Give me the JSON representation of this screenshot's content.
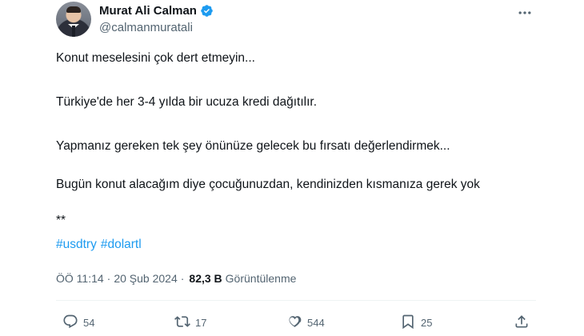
{
  "author": {
    "name": "Murat Ali Calman",
    "handle": "@calmanmuratali",
    "verified_icon": "verified-badge-icon",
    "badge_color": "#1d9bf0"
  },
  "tweet": {
    "lines": [
      "Konut meselesini çok dert etmeyin...",
      "Türkiye'de her 3-4 yılda bir ucuza kredi dağıtılır.",
      "Yapmanız gereken tek şey önünüze gelecek bu fırsatı değerlendirmek...",
      "Bugün konut alacağım diye çocuğunuzdan, kendinizden kısmanıza gerek yok",
      "**"
    ],
    "hashtags": [
      "#usdtry",
      "#dolartl"
    ]
  },
  "meta": {
    "time": "ÖÖ 11:14",
    "separator": "·",
    "date": "20 Şub 2024",
    "views_count": "82,3 B",
    "views_label": "Görüntülenme"
  },
  "actions": {
    "reply_count": "54",
    "retweet_count": "17",
    "like_count": "544",
    "bookmark_count": "25"
  },
  "colors": {
    "link": "#1d9bf0",
    "secondary_text": "#536471",
    "primary_text": "#0f1419"
  }
}
